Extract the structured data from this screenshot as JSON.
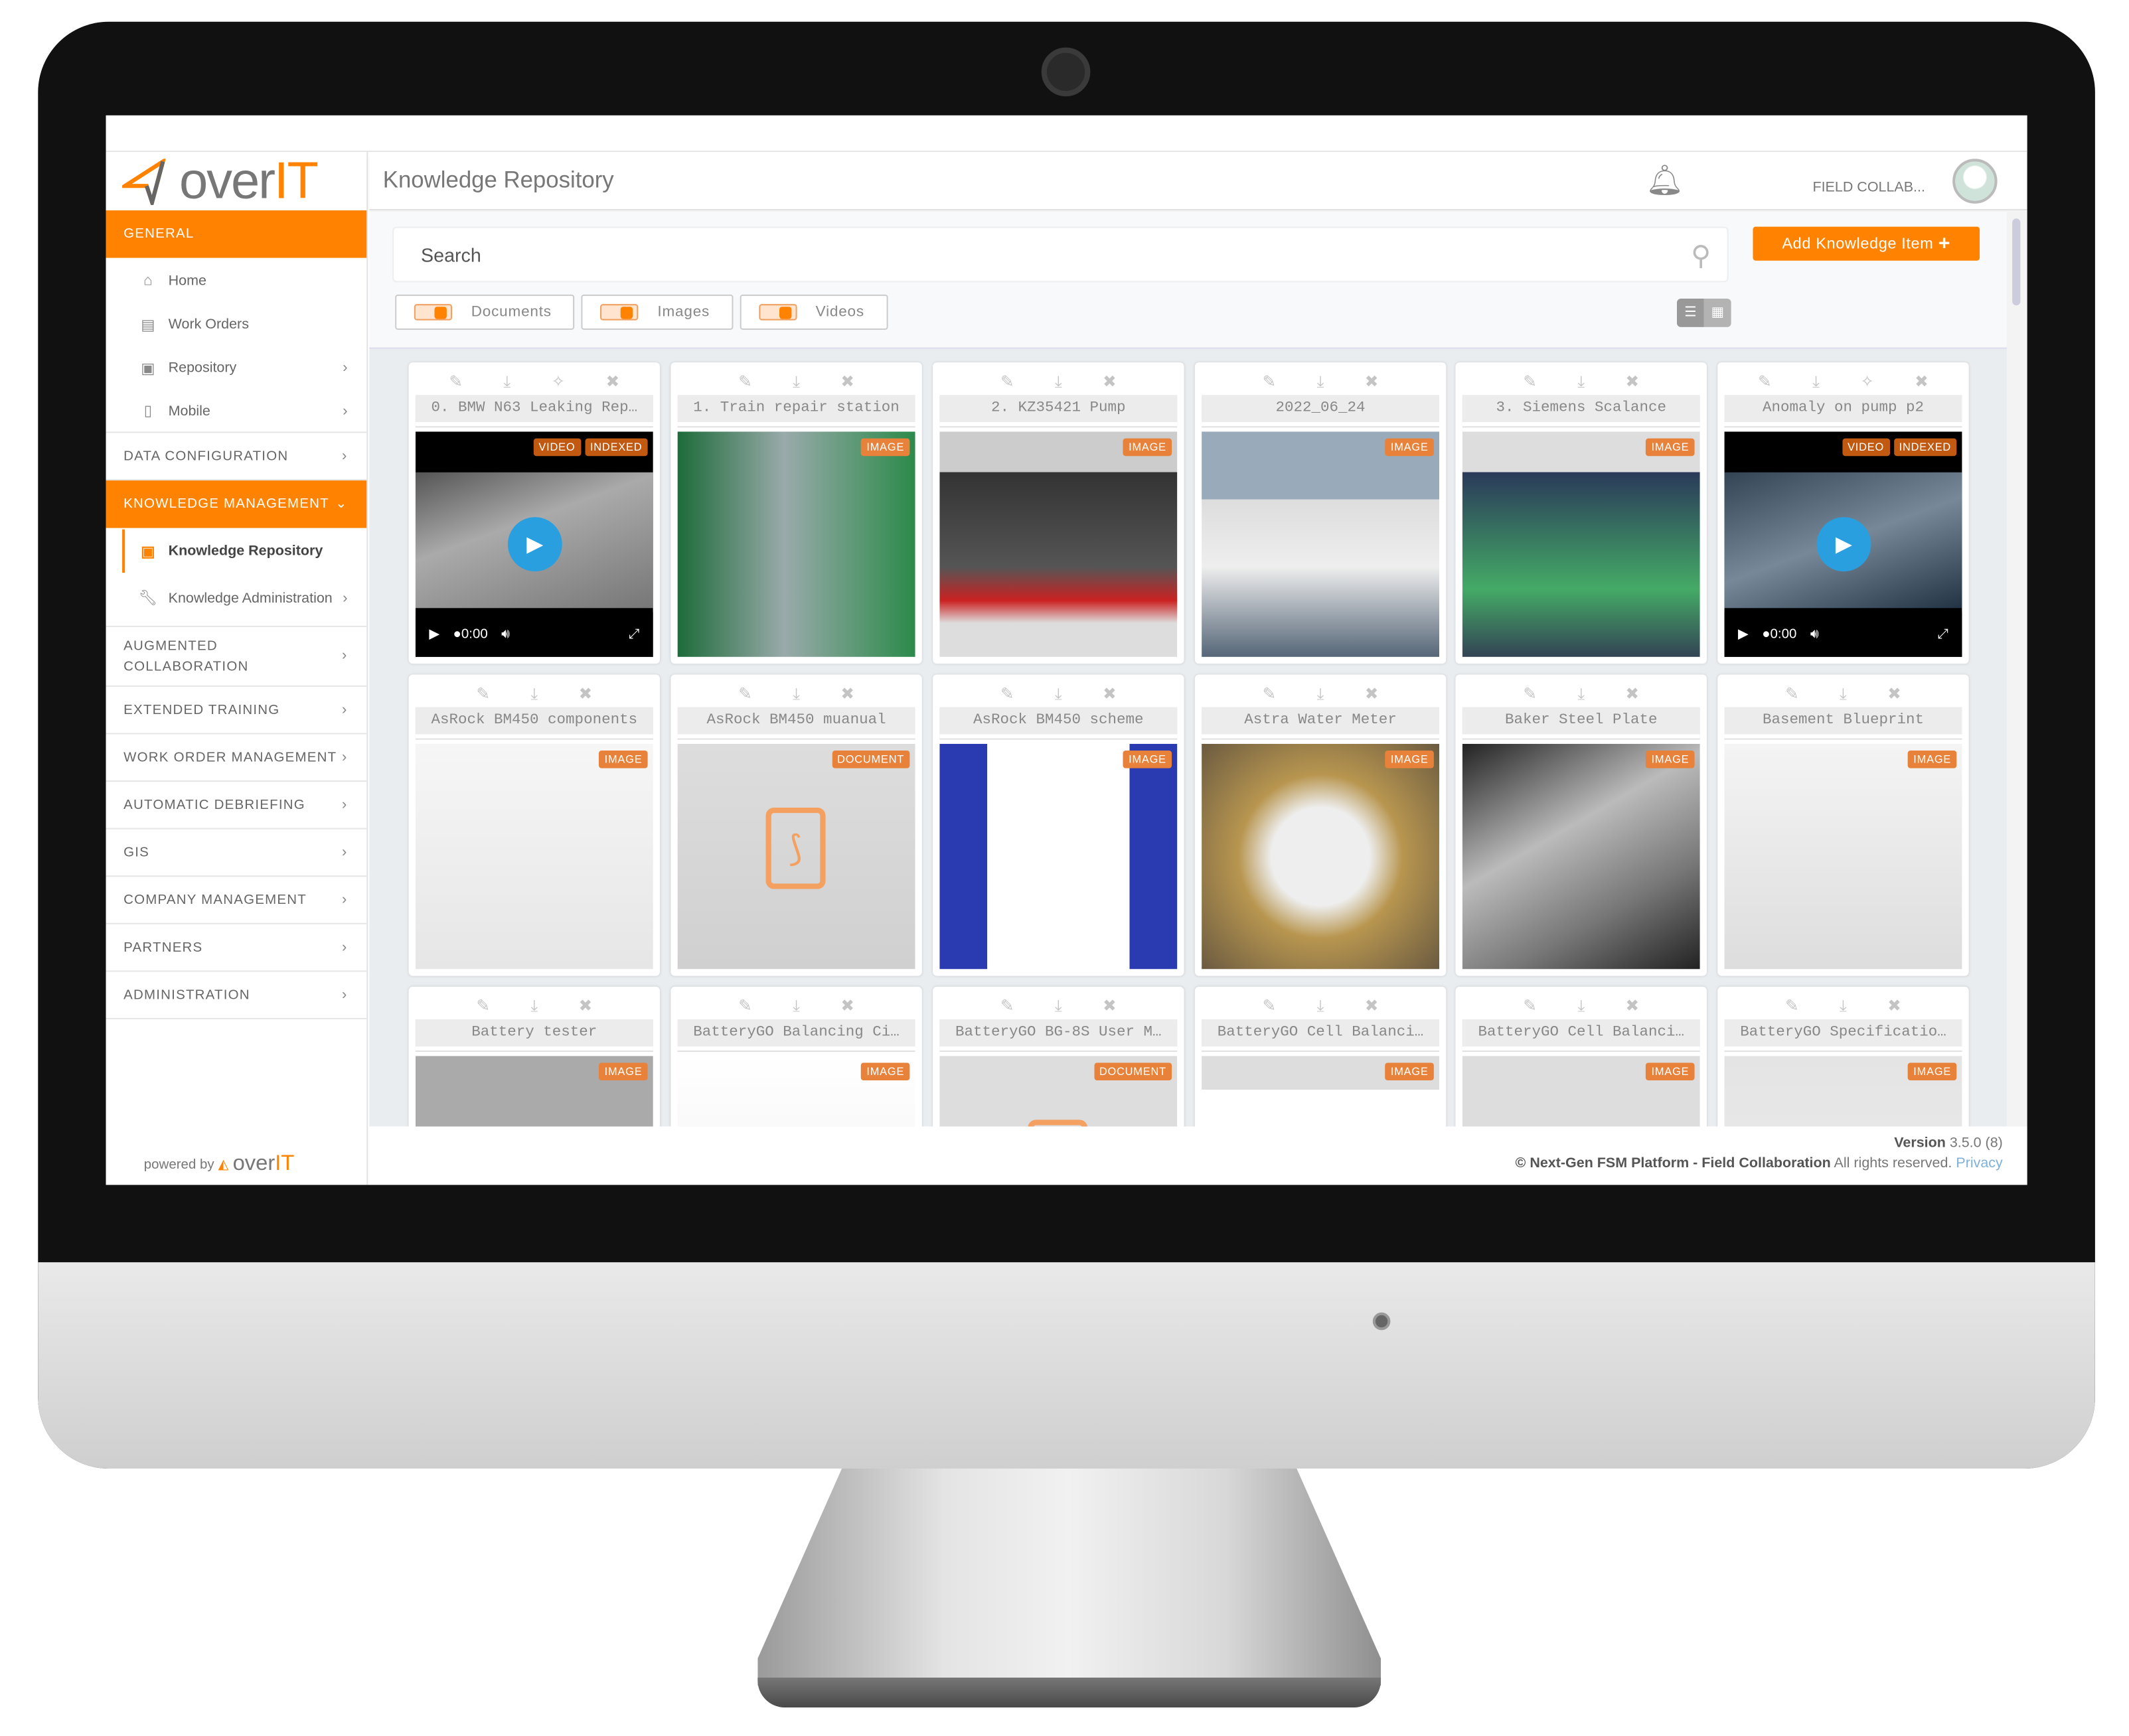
{
  "app": {
    "brand_prefix": "over",
    "brand_suffix": "IT",
    "page_title": "Knowledge Repository",
    "user": "FIELD COLLAB...",
    "accent": "#ff8200"
  },
  "sidebar": {
    "general": "GENERAL",
    "general_items": [
      {
        "label": "Home"
      },
      {
        "label": "Work Orders"
      },
      {
        "label": "Repository"
      },
      {
        "label": "Mobile"
      }
    ],
    "data_config": "DATA CONFIGURATION",
    "knowledge_management": "KNOWLEDGE MANAGEMENT",
    "km_items": [
      {
        "label": "Knowledge Repository"
      },
      {
        "label": "Knowledge Administration"
      }
    ],
    "sections": [
      {
        "label": "AUGMENTED COLLABORATION"
      },
      {
        "label": "EXTENDED TRAINING"
      },
      {
        "label": "WORK ORDER MANAGEMENT"
      },
      {
        "label": "AUTOMATIC DEBRIEFING"
      },
      {
        "label": "GIS"
      },
      {
        "label": "COMPANY MANAGEMENT"
      },
      {
        "label": "PARTNERS"
      },
      {
        "label": "ADMINISTRATION"
      }
    ],
    "powered_by": "powered by"
  },
  "toolbar": {
    "search_placeholder": "Search",
    "add_label": "Add Knowledge Item",
    "filters": [
      {
        "label": "Documents",
        "on": true
      },
      {
        "label": "Images",
        "on": true
      },
      {
        "label": "Videos",
        "on": true
      }
    ],
    "view_mode": "list"
  },
  "cards": [
    {
      "title": "0. BMW N63 Leaking Rep…",
      "badges": [
        "VIDEO",
        "INDEXED"
      ],
      "video": true,
      "time": "0:00",
      "wand": true
    },
    {
      "title": "1. Train repair station",
      "badges": [
        "IMAGE"
      ]
    },
    {
      "title": "2. KZ35421 Pump",
      "badges": [
        "IMAGE"
      ]
    },
    {
      "title": "2022_06_24",
      "badges": [
        "IMAGE"
      ]
    },
    {
      "title": "3. Siemens Scalance",
      "badges": [
        "IMAGE"
      ]
    },
    {
      "title": "Anomaly on pump p2",
      "badges": [
        "VIDEO",
        "INDEXED"
      ],
      "video": true,
      "time": "0:00",
      "wand": true
    },
    {
      "title": "AsRock BM450 components",
      "badges": [
        "IMAGE"
      ]
    },
    {
      "title": "AsRock BM450 muanual",
      "badges": [
        "DOCUMENT"
      ],
      "doc": true
    },
    {
      "title": "AsRock BM450 scheme",
      "badges": [
        "IMAGE"
      ]
    },
    {
      "title": "Astra Water Meter",
      "badges": [
        "IMAGE"
      ]
    },
    {
      "title": "Baker Steel Plate",
      "badges": [
        "IMAGE"
      ]
    },
    {
      "title": "Basement Blueprint",
      "badges": [
        "IMAGE"
      ]
    },
    {
      "title": "Battery tester",
      "badges": [
        "IMAGE"
      ]
    },
    {
      "title": "BatteryGO Balancing Ci…",
      "badges": [
        "IMAGE"
      ]
    },
    {
      "title": "BatteryGO BG-8S User M…",
      "badges": [
        "DOCUMENT"
      ],
      "doc": true
    },
    {
      "title": "BatteryGO Cell Balanci…",
      "badges": [
        "IMAGE"
      ]
    },
    {
      "title": "BatteryGO Cell Balanci…",
      "badges": [
        "IMAGE"
      ]
    },
    {
      "title": "BatteryGO Specificatio…",
      "badges": [
        "IMAGE"
      ]
    }
  ],
  "footer": {
    "version_label": "Version",
    "version": "3.5.0 (8)",
    "copyright": "© Next-Gen FSM Platform - Field Collaboration",
    "rights": "All rights reserved.",
    "privacy": "Privacy"
  }
}
